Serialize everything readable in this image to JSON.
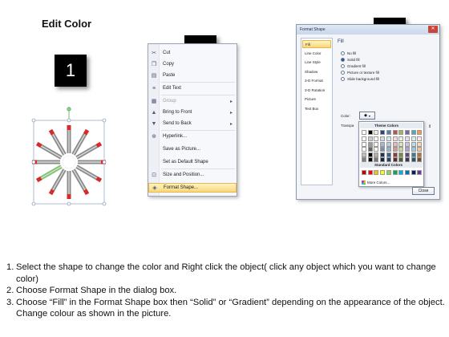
{
  "title": "Edit Color",
  "steps": {
    "one": "1",
    "two": "2",
    "three": "3"
  },
  "context_menu": {
    "items": [
      {
        "label": "Cut",
        "icon": "scissors-icon",
        "disabled": false,
        "submenu": false
      },
      {
        "label": "Copy",
        "icon": "copy-icon",
        "disabled": false,
        "submenu": false
      },
      {
        "label": "Paste",
        "icon": "paste-icon",
        "disabled": false,
        "submenu": false
      },
      {
        "label": "Edit Text",
        "icon": "edit-text-icon",
        "disabled": false,
        "submenu": false
      },
      {
        "label": "Group",
        "icon": "group-icon",
        "disabled": true,
        "submenu": true
      },
      {
        "label": "Bring to Front",
        "icon": "bring-to-front-icon",
        "disabled": false,
        "submenu": true
      },
      {
        "label": "Send to Back",
        "icon": "send-to-back-icon",
        "disabled": false,
        "submenu": true
      },
      {
        "label": "Hyperlink...",
        "icon": "hyperlink-icon",
        "disabled": false,
        "submenu": false
      },
      {
        "label": "Save as Picture...",
        "icon": "",
        "disabled": false,
        "submenu": false
      },
      {
        "label": "Set as Default Shape",
        "icon": "",
        "disabled": false,
        "submenu": false
      },
      {
        "label": "Size and Position...",
        "icon": "size-position-icon",
        "disabled": false,
        "submenu": false
      },
      {
        "label": "Format Shape...",
        "icon": "format-shape-icon",
        "disabled": false,
        "submenu": false,
        "highlighted": true
      }
    ]
  },
  "dialog": {
    "title": "Format Shape",
    "close_glyph": "✕",
    "nav": [
      "Fill",
      "Line Color",
      "Line Style",
      "Shadow",
      "3-D Format",
      "3-D Rotation",
      "Picture",
      "Text Box"
    ],
    "selected_nav": "Fill",
    "section_title": "Fill",
    "fill_options": [
      {
        "label": "No fill",
        "checked": false
      },
      {
        "label": "Solid fill",
        "checked": true
      },
      {
        "label": "Gradient fill",
        "checked": false
      },
      {
        "label": "Picture or texture fill",
        "checked": false
      },
      {
        "label": "Slide background fill",
        "checked": false
      }
    ],
    "color_label": "Color:",
    "transparency_label": "Transpa",
    "theme_colors_label": "Theme Colors",
    "standard_colors_label": "Standard Colors",
    "more_colors_label": "More Colors...",
    "close_button": "Close",
    "theme_top_row": [
      "#ffffff",
      "#000000",
      "#eeece1",
      "#1f497d",
      "#4f81bd",
      "#c0504d",
      "#9bbb59",
      "#8064a2",
      "#4bacc6",
      "#f79646"
    ],
    "standard_colors": [
      "#c00000",
      "#ff0000",
      "#ffc000",
      "#ffff00",
      "#92d050",
      "#00b050",
      "#00b0f0",
      "#0070c0",
      "#002060",
      "#7030a0"
    ]
  },
  "instructions": [
    {
      "num": "1.",
      "text": "Select the shape to change the color and Right click the object( click any object which you want to change color)"
    },
    {
      "num": "2.",
      "text": "Choose Format Shape in the dialog box."
    },
    {
      "num": "3.",
      "text": "Choose “Fill” in the Format Shape box then “Solid” or “Gradient” depending on the appearance of the object. Change colour as shown in the picture."
    }
  ]
}
